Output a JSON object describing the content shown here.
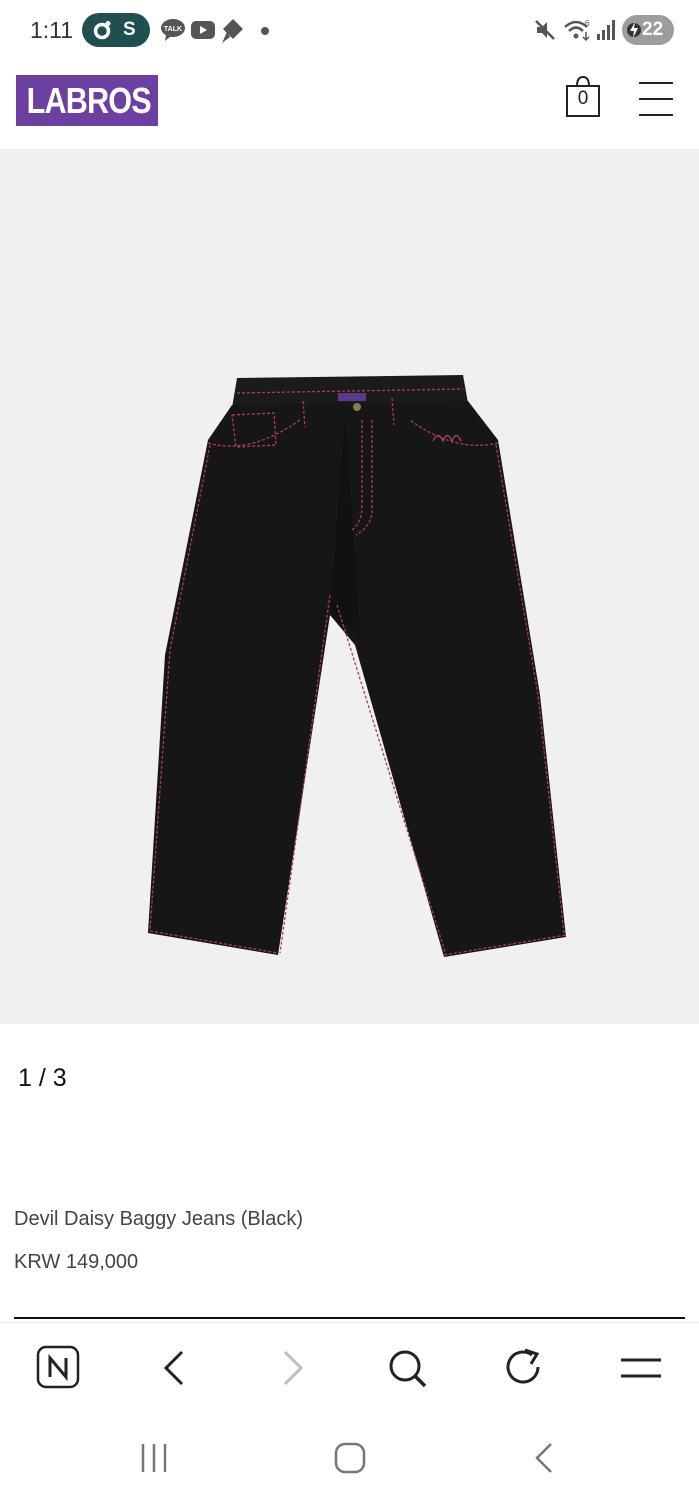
{
  "status_bar": {
    "time": "1:11",
    "pill_letter": "S",
    "battery": "22",
    "icons": [
      "talk-icon",
      "youtube-icon",
      "navigation-icon",
      "mute-icon",
      "wifi-icon",
      "signal-icon",
      "charging-icon"
    ]
  },
  "header": {
    "logo": "LABROS",
    "cart_count": "0",
    "brand_color": "#6b40a0"
  },
  "product": {
    "slide_counter": "1 / 3",
    "name": "Devil Daisy Baggy Jeans (Black)",
    "price": "KRW 149,000"
  },
  "browser_bar": {
    "buttons": [
      "naver-home-icon",
      "back-icon",
      "forward-icon",
      "search-icon",
      "refresh-icon",
      "menu-icon"
    ]
  },
  "system_nav": {
    "buttons": [
      "recent-apps-icon",
      "home-icon",
      "back-icon"
    ]
  }
}
